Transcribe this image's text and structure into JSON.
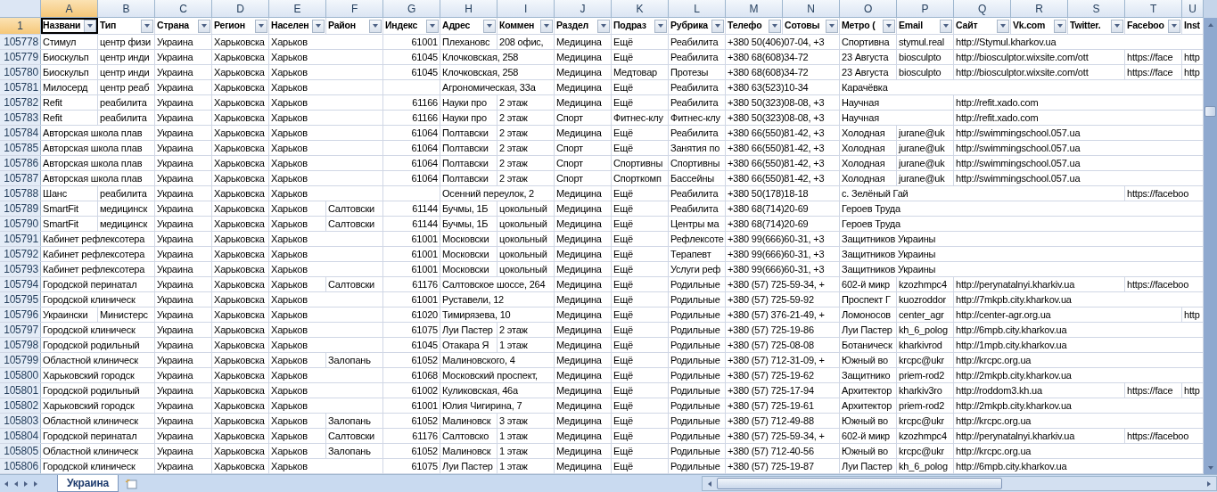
{
  "select_all": {
    "selected": false
  },
  "header_row": {
    "number": "1",
    "selected": true
  },
  "columns": [
    {
      "letter": "A",
      "label": "Названи",
      "kind": "text",
      "selected": true
    },
    {
      "letter": "B",
      "label": "Тип",
      "kind": "text",
      "selected": false
    },
    {
      "letter": "C",
      "label": "Страна",
      "kind": "text",
      "selected": false
    },
    {
      "letter": "D",
      "label": "Регион",
      "kind": "text",
      "selected": false
    },
    {
      "letter": "E",
      "label": "Населен",
      "kind": "text",
      "selected": false
    },
    {
      "letter": "F",
      "label": "Район",
      "kind": "text",
      "selected": false
    },
    {
      "letter": "G",
      "label": "Индекс",
      "kind": "number",
      "selected": false
    },
    {
      "letter": "H",
      "label": "Адрес",
      "kind": "text",
      "selected": false
    },
    {
      "letter": "I",
      "label": "Коммен",
      "kind": "text",
      "selected": false
    },
    {
      "letter": "J",
      "label": "Раздел",
      "kind": "text",
      "selected": false
    },
    {
      "letter": "K",
      "label": "Подраз",
      "kind": "text",
      "selected": false
    },
    {
      "letter": "L",
      "label": "Рубрика",
      "kind": "text",
      "selected": false
    },
    {
      "letter": "M",
      "label": "Телефо",
      "kind": "text",
      "selected": false
    },
    {
      "letter": "N",
      "label": "Сотовы",
      "kind": "text",
      "selected": false
    },
    {
      "letter": "O",
      "label": "Метро (",
      "kind": "text",
      "selected": false
    },
    {
      "letter": "P",
      "label": "Email",
      "kind": "text",
      "selected": false
    },
    {
      "letter": "Q",
      "label": "Сайт",
      "kind": "text",
      "selected": false
    },
    {
      "letter": "R",
      "label": "Vk.com",
      "kind": "text",
      "selected": false
    },
    {
      "letter": "S",
      "label": "Twitter.",
      "kind": "text",
      "selected": false
    },
    {
      "letter": "T",
      "label": "Faceboo",
      "kind": "text",
      "selected": false
    },
    {
      "letter": "U",
      "label": "Inst",
      "kind": "text",
      "selected": false
    }
  ],
  "rows": [
    {
      "number": "105778",
      "cells": {
        "A": "Стимул",
        "B": "центр физи",
        "C": "Украина",
        "D": "Харьковска",
        "E": "Харьков",
        "G": "61001",
        "H": "Плехановс",
        "I": "208 офис,",
        "J": "Медицина",
        "K": "Ещё",
        "L": "Реабилита",
        "M": "+380 50(406)07-04, +3",
        "O": "Спортивна",
        "P": "stymul.real",
        "Q": "http://Stymul.kharkov.ua"
      }
    },
    {
      "number": "105779",
      "cells": {
        "A": "Биоскульп",
        "B": "центр инди",
        "C": "Украина",
        "D": "Харьковска",
        "E": "Харьков",
        "G": "61045",
        "H": "Клочковская, 258",
        "J": "Медицина",
        "K": "Ещё",
        "L": "Реабилита",
        "M": "+380 68(608)34-72",
        "O": "23 Августа",
        "P": "biosculpto",
        "Q": "http://biosculptor.wixsite.com/ott",
        "T": "https://face",
        "U": "http"
      }
    },
    {
      "number": "105780",
      "cells": {
        "A": "Биоскульп",
        "B": "центр инди",
        "C": "Украина",
        "D": "Харьковска",
        "E": "Харьков",
        "G": "61045",
        "H": "Клочковская, 258",
        "J": "Медицина",
        "K": "Медтовар",
        "L": "Протезы",
        "M": "+380 68(608)34-72",
        "O": "23 Августа",
        "P": "biosculpto",
        "Q": "http://biosculptor.wixsite.com/ott",
        "T": "https://face",
        "U": "http"
      }
    },
    {
      "number": "105781",
      "cells": {
        "A": "Милосерд",
        "B": "центр реаб",
        "C": "Украина",
        "D": "Харьковска",
        "E": "Харьков",
        "H": "Агрономическая, 33а",
        "J": "Медицина",
        "K": "Ещё",
        "L": "Реабилита",
        "M": "+380 63(523)10-34",
        "O": "Карачёвка"
      }
    },
    {
      "number": "105782",
      "cells": {
        "A": "Refit",
        "B": "реабилита",
        "C": "Украина",
        "D": "Харьковска",
        "E": "Харьков",
        "G": "61166",
        "H": "Науки про",
        "I": "2 этаж",
        "J": "Медицина",
        "K": "Ещё",
        "L": "Реабилита",
        "M": "+380 50(323)08-08, +3",
        "O": "Научная",
        "Q": "http://refit.xado.com"
      }
    },
    {
      "number": "105783",
      "cells": {
        "A": "Refit",
        "B": "реабилита",
        "C": "Украина",
        "D": "Харьковска",
        "E": "Харьков",
        "G": "61166",
        "H": "Науки про",
        "I": "2 этаж",
        "J": "Спорт",
        "K": "Фитнес-клу",
        "L": "Фитнес-клу",
        "M": "+380 50(323)08-08, +3",
        "O": "Научная",
        "Q": "http://refit.xado.com"
      }
    },
    {
      "number": "105784",
      "cells": {
        "A": "Авторская школа плав",
        "C": "Украина",
        "D": "Харьковска",
        "E": "Харьков",
        "G": "61064",
        "H": "Полтавски",
        "I": "2 этаж",
        "J": "Медицина",
        "K": "Ещё",
        "L": "Реабилита",
        "M": "+380 66(550)81-42, +3",
        "O": "Холодная",
        "P": "jurane@uk",
        "Q": "http://swimmingschool.057.ua"
      }
    },
    {
      "number": "105785",
      "cells": {
        "A": "Авторская школа плав",
        "C": "Украина",
        "D": "Харьковска",
        "E": "Харьков",
        "G": "61064",
        "H": "Полтавски",
        "I": "2 этаж",
        "J": "Спорт",
        "K": "Ещё",
        "L": "Занятия по",
        "M": "+380 66(550)81-42, +3",
        "O": "Холодная",
        "P": "jurane@uk",
        "Q": "http://swimmingschool.057.ua"
      }
    },
    {
      "number": "105786",
      "cells": {
        "A": "Авторская школа плав",
        "C": "Украина",
        "D": "Харьковска",
        "E": "Харьков",
        "G": "61064",
        "H": "Полтавски",
        "I": "2 этаж",
        "J": "Спорт",
        "K": "Спортивны",
        "L": "Спортивны",
        "M": "+380 66(550)81-42, +3",
        "O": "Холодная",
        "P": "jurane@uk",
        "Q": "http://swimmingschool.057.ua"
      }
    },
    {
      "number": "105787",
      "cells": {
        "A": "Авторская школа плав",
        "C": "Украина",
        "D": "Харьковска",
        "E": "Харьков",
        "G": "61064",
        "H": "Полтавски",
        "I": "2 этаж",
        "J": "Спорт",
        "K": "Спорткомп",
        "L": "Бассейны",
        "M": "+380 66(550)81-42, +3",
        "O": "Холодная",
        "P": "jurane@uk",
        "Q": "http://swimmingschool.057.ua"
      }
    },
    {
      "number": "105788",
      "cells": {
        "A": "Шанс",
        "B": "реабилита",
        "C": "Украина",
        "D": "Харьковска",
        "E": "Харьков",
        "H": "Осенний переулок, 2",
        "J": "Медицина",
        "K": "Ещё",
        "L": "Реабилита",
        "M": "+380 50(178)18-18",
        "O": "с. Зелёный Гай",
        "T": "https://faceboo"
      }
    },
    {
      "number": "105789",
      "cells": {
        "A": "SmartFit",
        "B": "медицинск",
        "C": "Украина",
        "D": "Харьковска",
        "E": "Харьков",
        "F": "Салтовски",
        "G": "61144",
        "H": "Бучмы, 1Б",
        "I": "цокольный",
        "J": "Медицина",
        "K": "Ещё",
        "L": "Реабилита",
        "M": "+380 68(714)20-69",
        "O": "Героев Труда"
      }
    },
    {
      "number": "105790",
      "cells": {
        "A": "SmartFit",
        "B": "медицинск",
        "C": "Украина",
        "D": "Харьковска",
        "E": "Харьков",
        "F": "Салтовски",
        "G": "61144",
        "H": "Бучмы, 1Б",
        "I": "цокольный",
        "J": "Медицина",
        "K": "Ещё",
        "L": "Центры ма",
        "M": "+380 68(714)20-69",
        "O": "Героев Труда"
      }
    },
    {
      "number": "105791",
      "cells": {
        "A": "Кабинет рефлексотера",
        "C": "Украина",
        "D": "Харьковска",
        "E": "Харьков",
        "G": "61001",
        "H": "Московски",
        "I": "цокольный",
        "J": "Медицина",
        "K": "Ещё",
        "L": "Рефлексоте",
        "M": "+380 99(666)60-31, +3",
        "O": "Защитников Украины"
      }
    },
    {
      "number": "105792",
      "cells": {
        "A": "Кабинет рефлексотера",
        "C": "Украина",
        "D": "Харьковска",
        "E": "Харьков",
        "G": "61001",
        "H": "Московски",
        "I": "цокольный",
        "J": "Медицина",
        "K": "Ещё",
        "L": "Терапевт",
        "M": "+380 99(666)60-31, +3",
        "O": "Защитников Украины"
      }
    },
    {
      "number": "105793",
      "cells": {
        "A": "Кабинет рефлексотера",
        "C": "Украина",
        "D": "Харьковска",
        "E": "Харьков",
        "G": "61001",
        "H": "Московски",
        "I": "цокольный",
        "J": "Медицина",
        "K": "Ещё",
        "L": "Услуги реф",
        "M": "+380 99(666)60-31, +3",
        "O": "Защитников Украины"
      }
    },
    {
      "number": "105794",
      "cells": {
        "A": "Городской перинатал",
        "C": "Украина",
        "D": "Харьковска",
        "E": "Харьков",
        "F": "Салтовски",
        "G": "61176",
        "H": "Салтовское шоссе, 264",
        "J": "Медицина",
        "K": "Ещё",
        "L": "Родильные",
        "M": "+380 (57) 725-59-34, +",
        "O": "602-й микр",
        "P": "kzozhmpc4",
        "Q": "http://perynatalnyi.kharkiv.ua",
        "T": "https://faceboo"
      }
    },
    {
      "number": "105795",
      "cells": {
        "A": "Городской клиническ",
        "C": "Украина",
        "D": "Харьковска",
        "E": "Харьков",
        "G": "61001",
        "H": "Руставели, 12",
        "J": "Медицина",
        "K": "Ещё",
        "L": "Родильные",
        "M": "+380 (57) 725-59-92",
        "O": "Проспект Г",
        "P": "kuozroddor",
        "Q": "http://7mkpb.city.kharkov.ua"
      }
    },
    {
      "number": "105796",
      "cells": {
        "A": "Украински",
        "B": "Министерс",
        "C": "Украина",
        "D": "Харьковска",
        "E": "Харьков",
        "G": "61020",
        "H": "Тимирязева, 10",
        "J": "Медицина",
        "K": "Ещё",
        "L": "Родильные",
        "M": "+380 (57) 376-21-49, +",
        "O": "Ломоносов",
        "P": "center_agr",
        "Q": "http://center-agr.org.ua",
        "U": "http"
      }
    },
    {
      "number": "105797",
      "cells": {
        "A": "Городской клиническ",
        "C": "Украина",
        "D": "Харьковска",
        "E": "Харьков",
        "G": "61075",
        "H": "Луи Пастер",
        "I": "2 этаж",
        "J": "Медицина",
        "K": "Ещё",
        "L": "Родильные",
        "M": "+380 (57) 725-19-86",
        "O": "Луи Пастер",
        "P": "kh_6_polog",
        "Q": "http://6mpb.city.kharkov.ua"
      }
    },
    {
      "number": "105798",
      "cells": {
        "A": "Городской родильный",
        "C": "Украина",
        "D": "Харьковска",
        "E": "Харьков",
        "G": "61045",
        "H": "Отакара Я",
        "I": "1 этаж",
        "J": "Медицина",
        "K": "Ещё",
        "L": "Родильные",
        "M": "+380 (57) 725-08-08",
        "O": "Ботаническ",
        "P": "kharkivrod",
        "Q": "http://1mpb.city.kharkov.ua"
      }
    },
    {
      "number": "105799",
      "cells": {
        "A": "Областной клиническ",
        "C": "Украина",
        "D": "Харьковска",
        "E": "Харьков",
        "F": "Залопань",
        "G": "61052",
        "H": "Малиновского, 4",
        "J": "Медицина",
        "K": "Ещё",
        "L": "Родильные",
        "M": "+380 (57) 712-31-09, +",
        "O": "Южный во",
        "P": "krcpc@ukr",
        "Q": "http://krcpc.org.ua"
      }
    },
    {
      "number": "105800",
      "cells": {
        "A": "Харьковский городск",
        "C": "Украина",
        "D": "Харьковска",
        "E": "Харьков",
        "G": "61068",
        "H": "Московский проспект,",
        "J": "Медицина",
        "K": "Ещё",
        "L": "Родильные",
        "M": "+380 (57) 725-19-62",
        "O": "Защитнико",
        "P": "priem-rod2",
        "Q": "http://2mkpb.city.kharkov.ua"
      }
    },
    {
      "number": "105801",
      "cells": {
        "A": "Городской родильный",
        "C": "Украина",
        "D": "Харьковска",
        "E": "Харьков",
        "G": "61002",
        "H": "Куликовская, 46а",
        "J": "Медицина",
        "K": "Ещё",
        "L": "Родильные",
        "M": "+380 (57) 725-17-94",
        "O": "Архитектор",
        "P": "kharkiv3ro",
        "Q": "http://roddom3.kh.ua",
        "T": "https://face",
        "U": "http"
      }
    },
    {
      "number": "105802",
      "cells": {
        "A": "Харьковский городск",
        "C": "Украина",
        "D": "Харьковска",
        "E": "Харьков",
        "G": "61001",
        "H": "Юлия Чигирина, 7",
        "J": "Медицина",
        "K": "Ещё",
        "L": "Родильные",
        "M": "+380 (57) 725-19-61",
        "O": "Архитектор",
        "P": "priem-rod2",
        "Q": "http://2mkpb.city.kharkov.ua"
      }
    },
    {
      "number": "105803",
      "cells": {
        "A": "Областной клиническ",
        "C": "Украина",
        "D": "Харьковска",
        "E": "Харьков",
        "F": "Залопань",
        "G": "61052",
        "H": "Малиновск",
        "I": "3 этаж",
        "J": "Медицина",
        "K": "Ещё",
        "L": "Родильные",
        "M": "+380 (57) 712-49-88",
        "O": "Южный во",
        "P": "krcpc@ukr",
        "Q": "http://krcpc.org.ua"
      }
    },
    {
      "number": "105804",
      "cells": {
        "A": "Городской перинатал",
        "C": "Украина",
        "D": "Харьковска",
        "E": "Харьков",
        "F": "Салтовски",
        "G": "61176",
        "H": "Салтовско",
        "I": "1 этаж",
        "J": "Медицина",
        "K": "Ещё",
        "L": "Родильные",
        "M": "+380 (57) 725-59-34, +",
        "O": "602-й микр",
        "P": "kzozhmpc4",
        "Q": "http://perynatalnyi.kharkiv.ua",
        "T": "https://faceboo"
      }
    },
    {
      "number": "105805",
      "cells": {
        "A": "Областной клиническ",
        "C": "Украина",
        "D": "Харьковска",
        "E": "Харьков",
        "F": "Залопань",
        "G": "61052",
        "H": "Малиновск",
        "I": "1 этаж",
        "J": "Медицина",
        "K": "Ещё",
        "L": "Родильные",
        "M": "+380 (57) 712-40-56",
        "O": "Южный во",
        "P": "krcpc@ukr",
        "Q": "http://krcpc.org.ua"
      }
    },
    {
      "number": "105806",
      "cells": {
        "A": "Городской клиническ",
        "C": "Украина",
        "D": "Харьковска",
        "E": "Харьков",
        "G": "61075",
        "H": "Луи Пастер",
        "I": "1 этаж",
        "J": "Медицина",
        "K": "Ещё",
        "L": "Родильные",
        "M": "+380 (57) 725-19-87",
        "O": "Луи Пастер",
        "P": "kh_6_polog",
        "Q": "http://6mpb.city.kharkov.ua"
      }
    }
  ],
  "sheet_tabs": [
    {
      "label": "Украина",
      "selected": true
    }
  ]
}
